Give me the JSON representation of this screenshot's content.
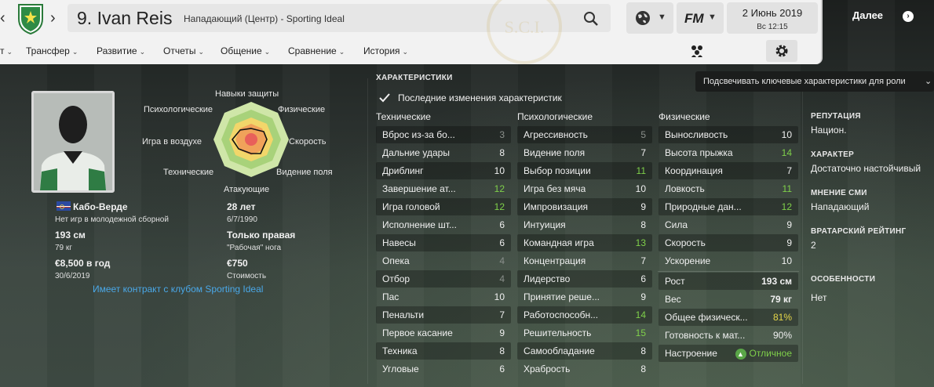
{
  "header": {
    "player_name": "9. Ivan Reis",
    "player_subtitle": "Нападающий (Центр) - Sporting Ideal",
    "date": "2 Июнь 2019",
    "time": "Вс 12:15",
    "brand_label": "FM",
    "next_label": "Далее",
    "watermark_text": "S.C.I."
  },
  "menu": {
    "items": [
      "т",
      "Трансфер",
      "Развитие",
      "Отчеты",
      "Общение",
      "Сравнение",
      "История"
    ]
  },
  "profile": {
    "nationality": "Кабо-Верде",
    "youth_caps": "Нет игр в молодежной сборной",
    "age": "28 лет",
    "birthdate": "6/7/1990",
    "height": "193 см",
    "weight": "79 кг",
    "foot": "Только правая",
    "foot_sub": "\"Рабочая\" нога",
    "wage": "€8,500 в год",
    "wage_until": "30/6/2019",
    "value": "€750",
    "value_label": "Стоимость",
    "contract_text": "Имеет контракт с клубом Sporting Ideal"
  },
  "radar": {
    "labels": [
      "Навыки защиты",
      "Физические",
      "Скорость",
      "Видение поля",
      "Атакующие",
      "Технические",
      "Игра в воздухе",
      "Психологические"
    ]
  },
  "attributes": {
    "title": "ХАРАКТЕРИСТИКИ",
    "recent_changes_label": "Последние изменения характеристик",
    "recent_changes_checked": true,
    "technical_head": "Технические",
    "mental_head": "Психологические",
    "physical_head": "Физические",
    "technical": [
      {
        "name": "Вброс из-за бо...",
        "value": "3",
        "tone": "dim"
      },
      {
        "name": "Дальние удары",
        "value": "8",
        "tone": "normal"
      },
      {
        "name": "Дриблинг",
        "value": "10",
        "tone": "normal"
      },
      {
        "name": "Завершение ат...",
        "value": "12",
        "tone": "green"
      },
      {
        "name": "Игра головой",
        "value": "12",
        "tone": "green"
      },
      {
        "name": "Исполнение шт...",
        "value": "6",
        "tone": "normal"
      },
      {
        "name": "Навесы",
        "value": "6",
        "tone": "normal"
      },
      {
        "name": "Опека",
        "value": "4",
        "tone": "dim"
      },
      {
        "name": "Отбор",
        "value": "4",
        "tone": "dim"
      },
      {
        "name": "Пас",
        "value": "10",
        "tone": "normal"
      },
      {
        "name": "Пенальти",
        "value": "7",
        "tone": "normal"
      },
      {
        "name": "Первое касание",
        "value": "9",
        "tone": "normal"
      },
      {
        "name": "Техника",
        "value": "8",
        "tone": "normal"
      },
      {
        "name": "Угловые",
        "value": "6",
        "tone": "normal"
      }
    ],
    "mental": [
      {
        "name": "Агрессивность",
        "value": "5",
        "tone": "dim"
      },
      {
        "name": "Видение поля",
        "value": "7",
        "tone": "normal"
      },
      {
        "name": "Выбор позиции",
        "value": "11",
        "tone": "green"
      },
      {
        "name": "Игра без мяча",
        "value": "10",
        "tone": "normal"
      },
      {
        "name": "Импровизация",
        "value": "9",
        "tone": "normal"
      },
      {
        "name": "Интуиция",
        "value": "8",
        "tone": "normal"
      },
      {
        "name": "Командная игра",
        "value": "13",
        "tone": "green"
      },
      {
        "name": "Концентрация",
        "value": "7",
        "tone": "normal"
      },
      {
        "name": "Лидерство",
        "value": "6",
        "tone": "normal"
      },
      {
        "name": "Принятие реше...",
        "value": "9",
        "tone": "normal"
      },
      {
        "name": "Работоспособн...",
        "value": "14",
        "tone": "green"
      },
      {
        "name": "Решительность",
        "value": "15",
        "tone": "green"
      },
      {
        "name": "Самообладание",
        "value": "8",
        "tone": "normal"
      },
      {
        "name": "Храбрость",
        "value": "8",
        "tone": "normal"
      }
    ],
    "physical": [
      {
        "name": "Выносливость",
        "value": "10",
        "tone": "normal"
      },
      {
        "name": "Высота прыжка",
        "value": "14",
        "tone": "green"
      },
      {
        "name": "Координация",
        "value": "7",
        "tone": "normal"
      },
      {
        "name": "Ловкость",
        "value": "11",
        "tone": "green"
      },
      {
        "name": "Природные дан...",
        "value": "12",
        "tone": "green"
      },
      {
        "name": "Сила",
        "value": "9",
        "tone": "normal"
      },
      {
        "name": "Скорость",
        "value": "9",
        "tone": "normal"
      },
      {
        "name": "Ускорение",
        "value": "10",
        "tone": "normal"
      }
    ],
    "physical_extra": [
      {
        "name": "Рост",
        "value": "193 см",
        "tone": "bold"
      },
      {
        "name": "Вес",
        "value": "79 кг",
        "tone": "bold"
      },
      {
        "name": "Общее физическ...",
        "value": "81%",
        "tone": "yellow"
      },
      {
        "name": "Готовность к мат...",
        "value": "90%",
        "tone": "normal"
      },
      {
        "name": "Настроение",
        "value": "Отличное",
        "tone": "green"
      }
    ]
  },
  "highlight_dropdown": "Подсвечивать ключевые характеристики для роли",
  "side_info": {
    "reputation_head": "РЕПУТАЦИЯ",
    "reputation": "Национ.",
    "character_head": "ХАРАКТЕР",
    "character": "Достаточно настойчивый",
    "media_head": "МНЕНИЕ СМИ",
    "media": "Нападающий",
    "gk_head": "ВРАТАРСКИЙ РЕЙТИНГ",
    "gk": "2",
    "features_head": "ОСОБЕННОСТИ",
    "features": "Нет"
  },
  "colors": {
    "green_value": "#7fd04a",
    "dim_value": "#8a8f8b",
    "link": "#4aa8e8",
    "yellow_value": "#e6d74a"
  }
}
